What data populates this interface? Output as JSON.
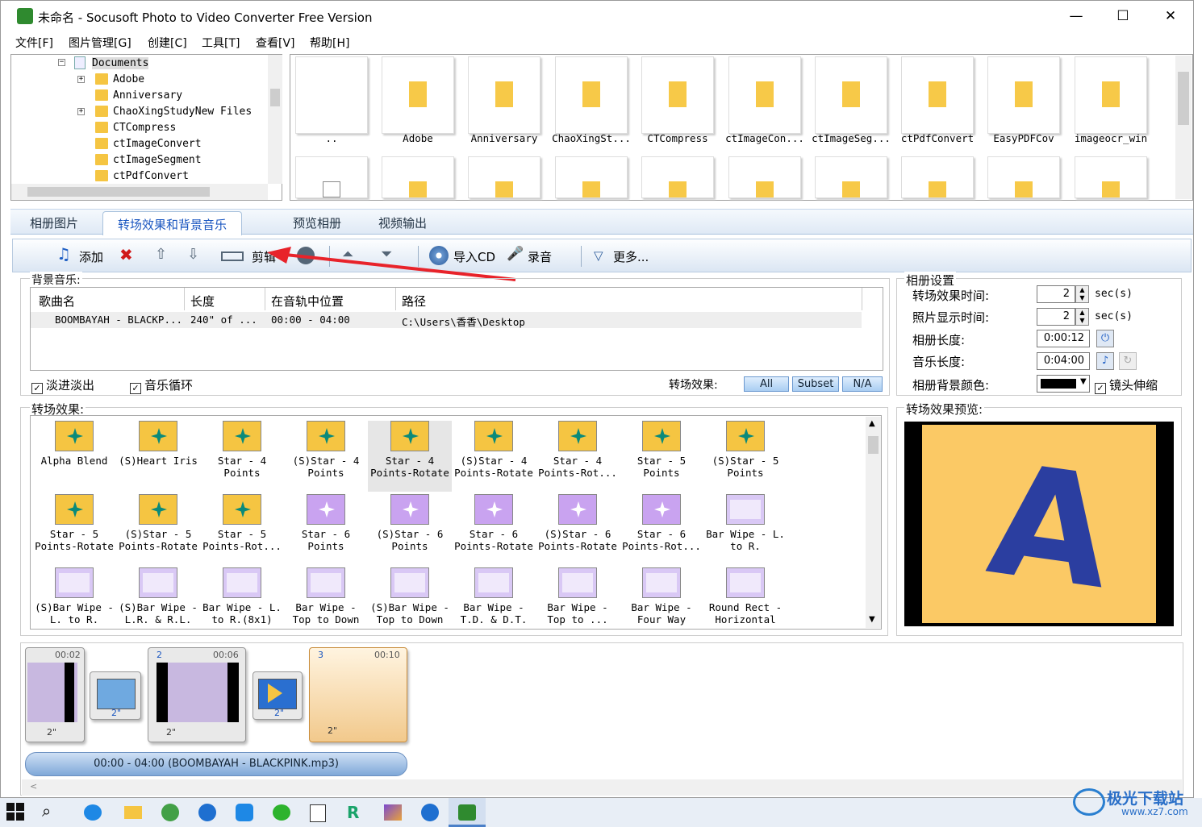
{
  "window": {
    "title": "未命名 - Socusoft Photo to Video Converter Free Version",
    "min": "—",
    "max": "☐",
    "close": "✕"
  },
  "menu": [
    "文件[F]",
    "图片管理[G]",
    "创建[C]",
    "工具[T]",
    "查看[V]",
    "帮助[H]"
  ],
  "tree": {
    "items": [
      "Documents",
      "Adobe",
      "Anniversary",
      "ChaoXingStudyNew Files",
      "CTCompress",
      "ctImageConvert",
      "ctImageSegment",
      "ctPdfConvert"
    ]
  },
  "thumbs": [
    "..",
    "Adobe",
    "Anniversary",
    "ChaoXingSt...",
    "CTCompress",
    "ctImageCon...",
    "ctImageSeg...",
    "ctPdfConvert",
    "EasyPDFCov",
    "imageocr_win"
  ],
  "tabs": [
    "相册图片",
    "转场效果和背景音乐",
    "预览相册",
    "视频输出"
  ],
  "toolbar": {
    "add": "添加",
    "trim": "剪辑",
    "import_cd": "导入CD",
    "record": "录音",
    "more": "更多..."
  },
  "music": {
    "group": "背景音乐:",
    "headers": [
      "歌曲名",
      "长度",
      "在音轨中位置",
      "路径"
    ],
    "row": [
      "BOOMBAYAH - BLACKP...",
      "240\" of ...",
      "00:00 - 04:00",
      "C:\\Users\\香香\\Desktop"
    ],
    "fade": "淡进淡出",
    "loop": "音乐循环",
    "effect_label": "转场效果:",
    "filters": [
      "All",
      "Subset",
      "N/A"
    ]
  },
  "settings": {
    "group": "相册设置",
    "labels": [
      "转场效果时间:",
      "照片显示时间:",
      "相册长度:",
      "音乐长度:",
      "相册背景颜色:"
    ],
    "transition_time": "2",
    "photo_time": "2",
    "unit": "sec(s)",
    "album_length": "0:00:12",
    "music_length": "0:04:00",
    "lens": "镜头伸缩"
  },
  "effects": {
    "group": "转场效果:",
    "items": [
      "Alpha Blend",
      "(S)Heart Iris",
      "Star - 4\nPoints",
      "(S)Star - 4\nPoints",
      "Star - 4\nPoints-Rotate",
      "(S)Star - 4\nPoints-Rotate",
      "Star - 4\nPoints-Rot...",
      "Star - 5\nPoints",
      "(S)Star - 5\nPoints",
      "Star - 5\nPoints-Rotate",
      "(S)Star - 5\nPoints-Rotate",
      "Star - 5\nPoints-Rot...",
      "Star - 6\nPoints",
      "(S)Star - 6\nPoints",
      "Star - 6\nPoints-Rotate",
      "(S)Star - 6\nPoints-Rotate",
      "Star - 6\nPoints-Rot...",
      "Bar Wipe - L.\nto R.",
      "(S)Bar Wipe -\nL. to R.",
      "(S)Bar Wipe -\nL.R. & R.L.",
      "Bar Wipe - L.\nto R.(8x1)",
      "Bar Wipe -\nTop to Down",
      "(S)Bar Wipe -\nTop to Down",
      "Bar Wipe -\nT.D. & D.T.",
      "Bar Wipe -\nTop to ...",
      "Bar Wipe -\nFour Way",
      "Round Rect -\nHorizontal"
    ]
  },
  "preview": {
    "group": "转场效果预览:",
    "letter": "A"
  },
  "timeline": {
    "cards": [
      {
        "num": "",
        "time": "00:02",
        "dur": "2\""
      },
      {
        "num": "2",
        "time": "00:06",
        "dur": "2\""
      },
      {
        "num": "3",
        "time": "00:10",
        "dur": "2\""
      }
    ],
    "trans": [
      "2\"",
      "2\""
    ],
    "music_bar": "00:00 - 04:00 (BOOMBAYAH - BLACKPINK.mp3)"
  },
  "watermark": {
    "text": "极光下载站",
    "url": "www.xz7.com"
  },
  "colors": {
    "accent": "#1a56c0",
    "folder": "#f5c542",
    "preview_bg": "#fbc965",
    "preview_letter": "#2b3ea0"
  }
}
